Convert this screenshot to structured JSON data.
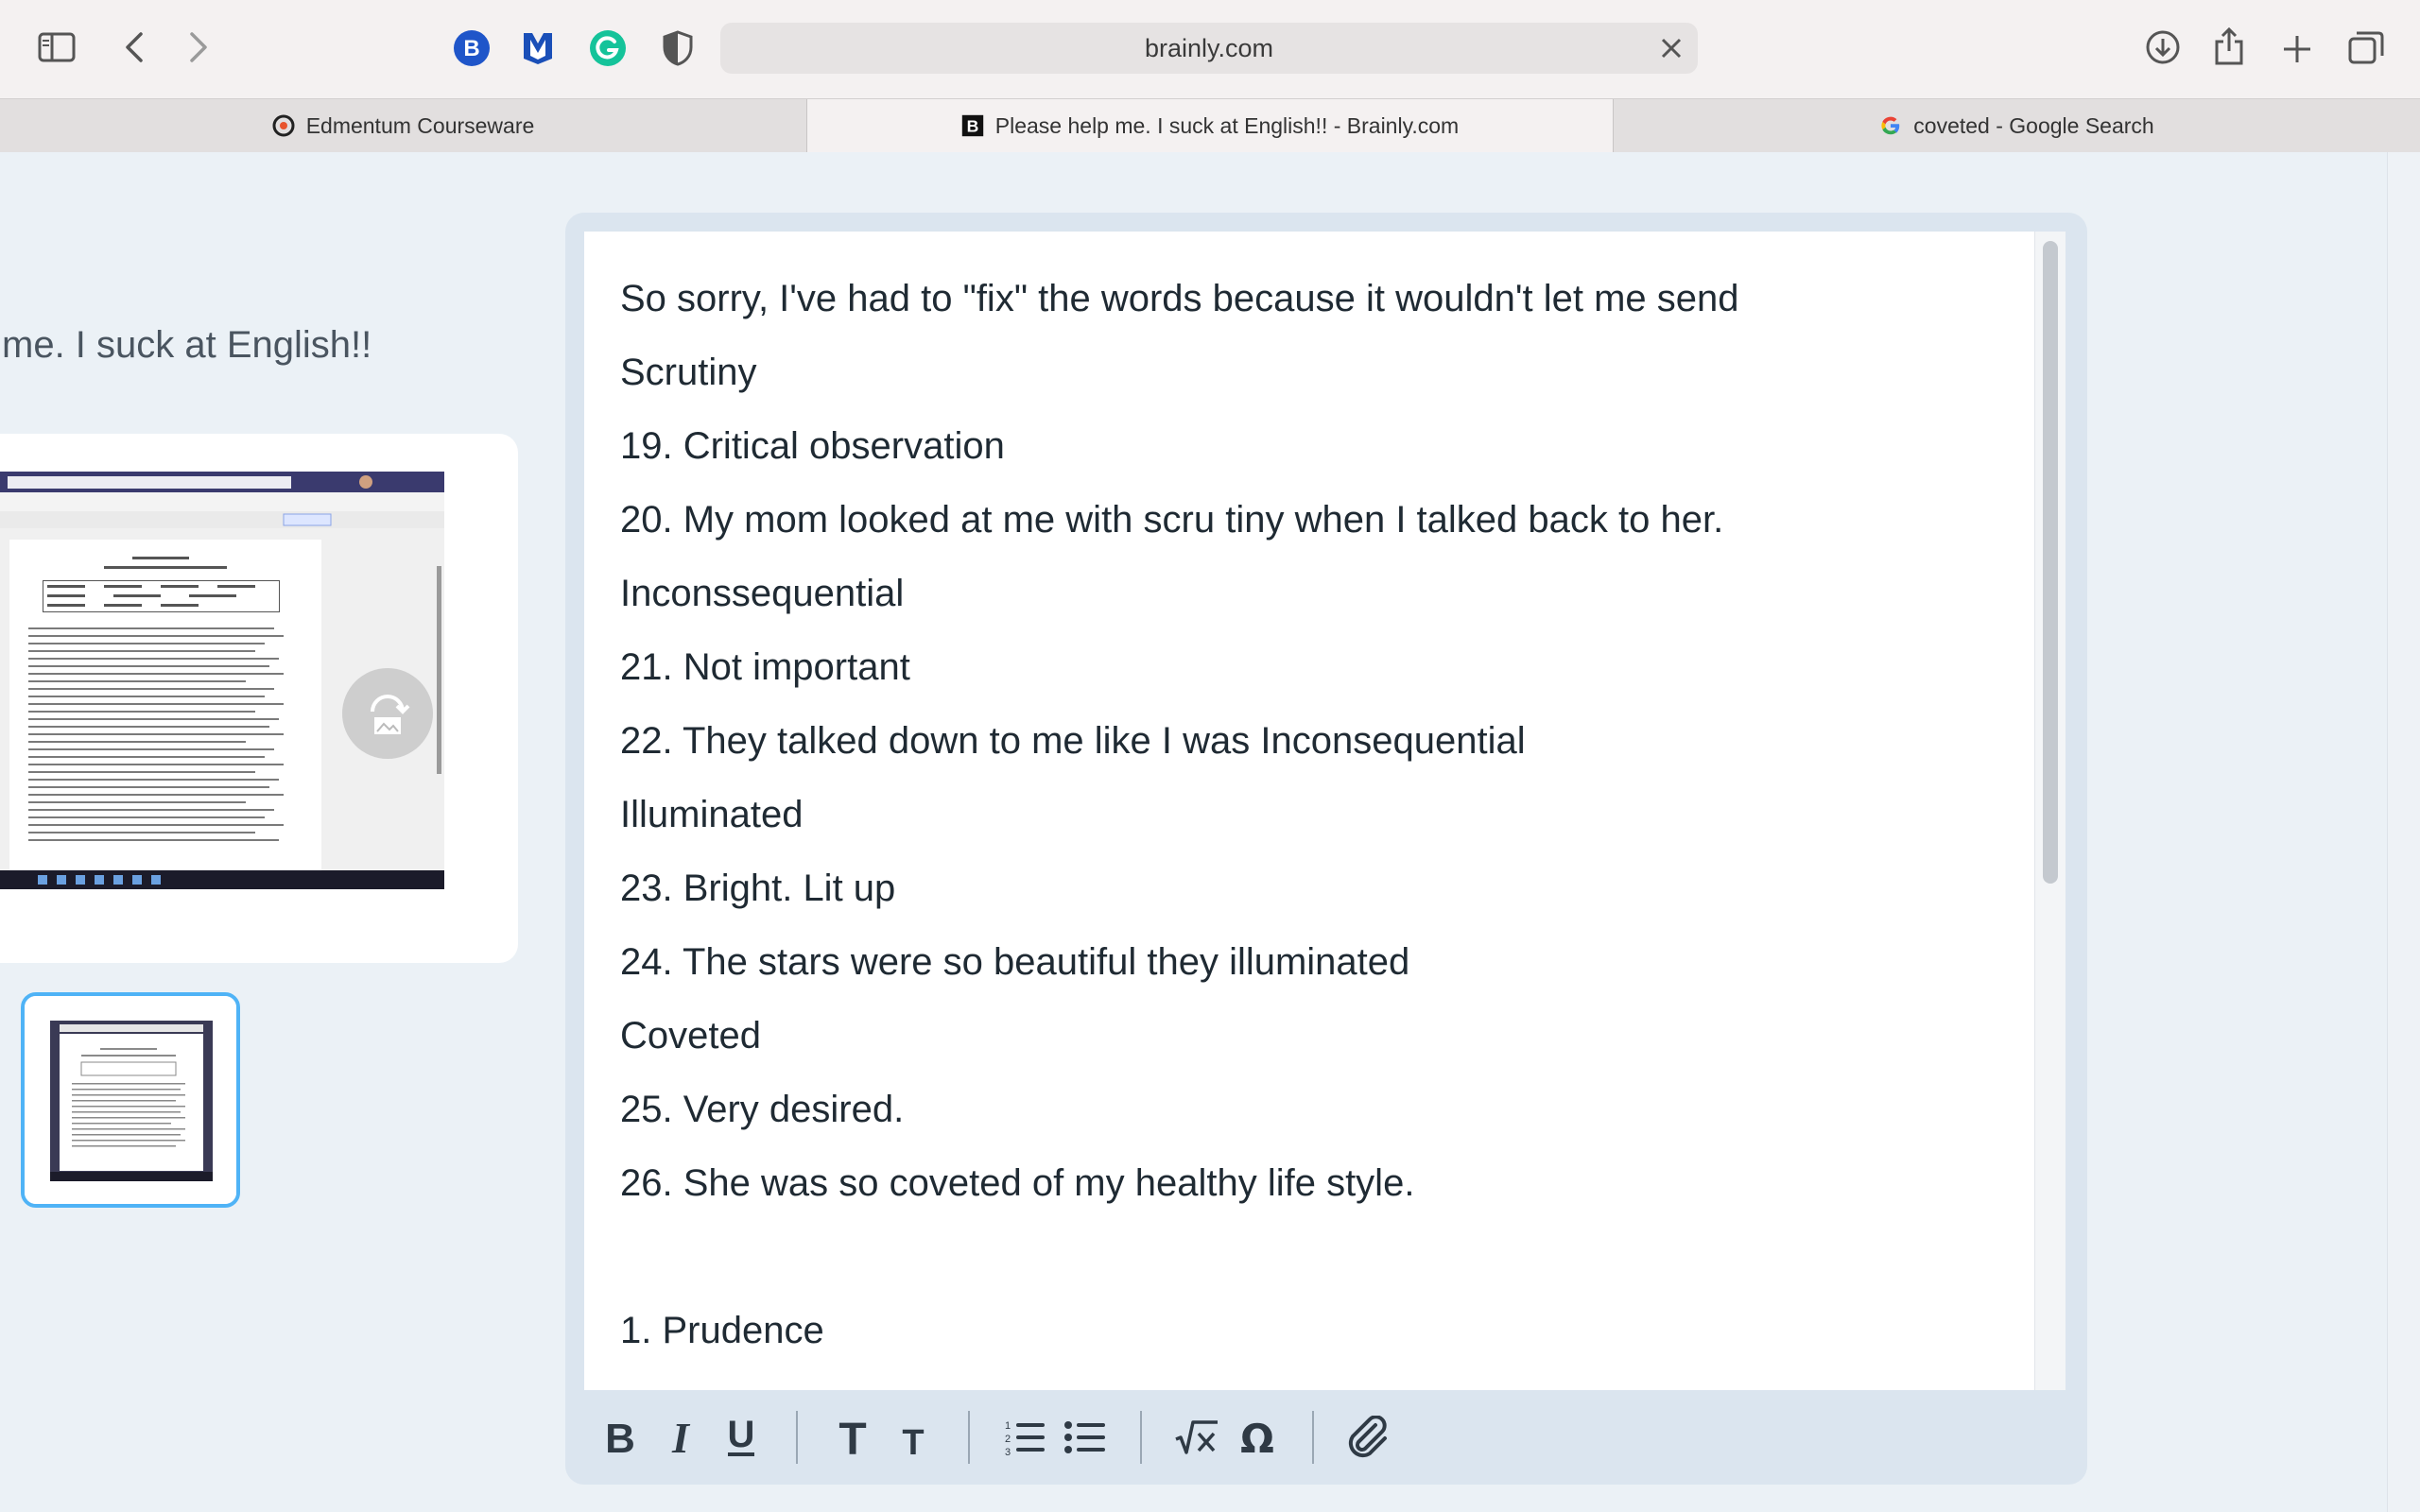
{
  "browser": {
    "url": "brainly.com",
    "tabs": [
      {
        "label": "Edmentum Courseware",
        "active": false
      },
      {
        "label": "Please help me. I suck at English!! - Brainly.com",
        "active": true
      },
      {
        "label": "coveted - Google Search",
        "active": false
      }
    ],
    "toolbar_icons": [
      "sidebar-icon",
      "back-icon",
      "forward-icon",
      "bitwarden-extension-icon",
      "malwarebytes-extension-icon",
      "grammarly-extension-icon",
      "privacy-extension-icon",
      "download-icon",
      "share-icon",
      "new-tab-icon",
      "tab-overview-icon"
    ]
  },
  "question": {
    "title_fragment": "me. I suck at English!!"
  },
  "answer_editor": {
    "lines": [
      "So sorry, I've had to \"fix\" the words because it wouldn't let me send",
      "Scrutiny",
      "19. Critical observation",
      "20. My mom looked at me with scru tiny when I talked back to her.",
      "Inconssequential",
      "21. Not important",
      "22. They talked down to me like I was Inconsequential",
      "Illuminated",
      "23. Bright. Lit up",
      "24. The stars were so beautiful they illuminated",
      "Coveted",
      "25. Very desired.",
      "26. She was so coveted of my healthy life style.",
      "",
      "1. Prudence"
    ],
    "format_buttons": [
      "bold",
      "italic",
      "underline",
      "heading-large",
      "heading-small",
      "numbered-list",
      "bullet-list",
      "math-formula",
      "special-symbol",
      "attachment"
    ]
  },
  "colors": {
    "accent_blue": "#4fb3f6",
    "editor_frame": "#dbe5ef",
    "page_bg": "#ebf1f6",
    "text": "#1f2a33"
  }
}
